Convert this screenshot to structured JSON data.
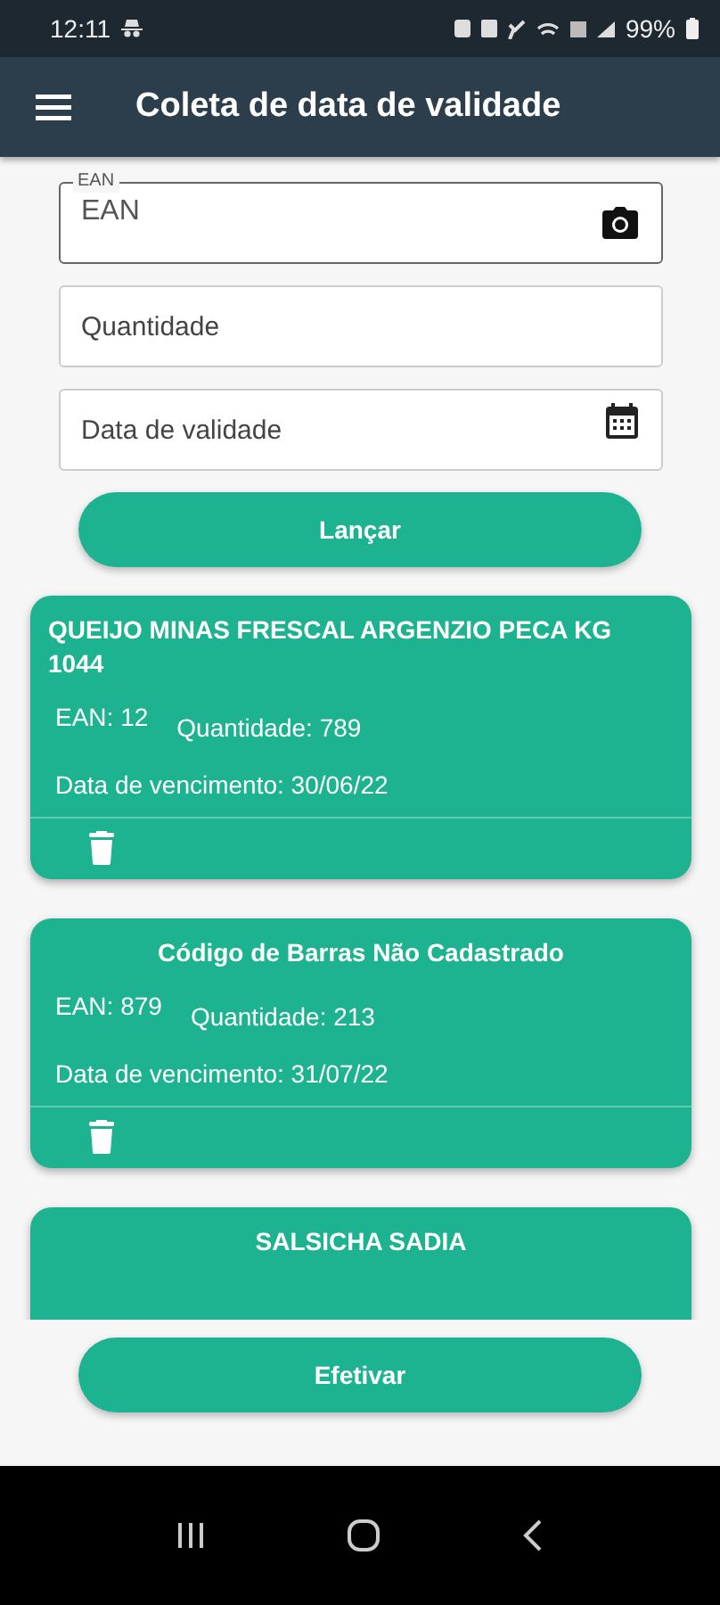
{
  "status_bar": {
    "time": "12:11",
    "battery": "99%"
  },
  "app_bar": {
    "title": "Coleta de data de validade"
  },
  "form": {
    "ean": {
      "label": "EAN",
      "placeholder": "EAN"
    },
    "quantity": {
      "placeholder": "Quantidade"
    },
    "expiry": {
      "placeholder": "Data de validade"
    },
    "submit_button": "Lançar"
  },
  "items": [
    {
      "title": "QUEIJO MINAS FRESCAL ARGENZIO PECA KG 1044",
      "ean": "EAN: 12",
      "quantity": "Quantidade: 789",
      "expiry": "Data de vencimento: 30/06/22"
    },
    {
      "title": "Código de Barras Não Cadastrado",
      "ean": "EAN: 879",
      "quantity": "Quantidade: 213",
      "expiry": "Data de vencimento: 31/07/22"
    },
    {
      "title": "SALSICHA SADIA"
    }
  ],
  "confirm_button": "Efetivar"
}
